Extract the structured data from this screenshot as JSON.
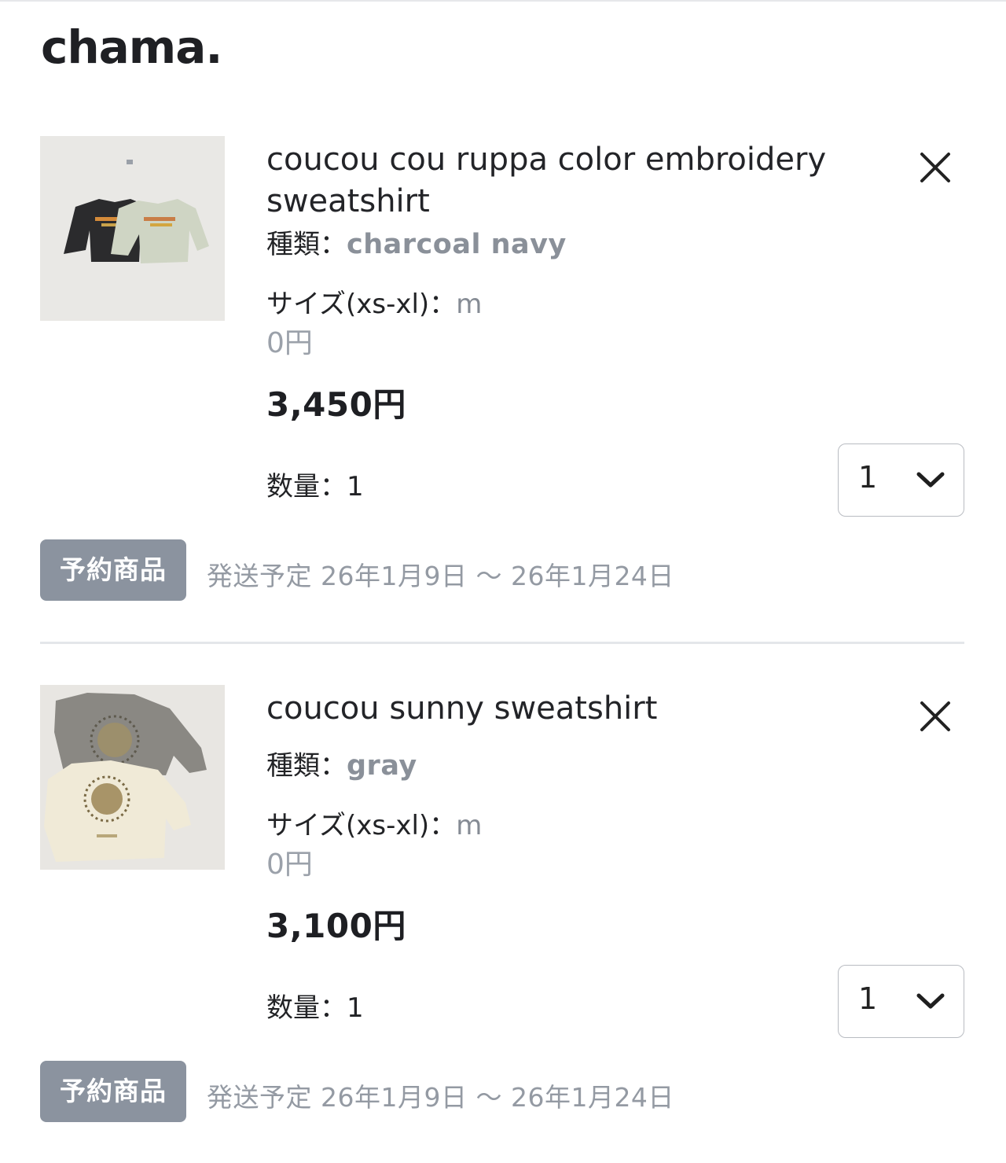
{
  "header": {
    "logo": "chama."
  },
  "cart": {
    "items": [
      {
        "title": "coucou cou ruppa color embroidery sweatshirt",
        "variant_label": "種類：",
        "variant_value": "charcoal navy",
        "size_label": "サイズ(xs-xl)：",
        "size_value": "m",
        "option_price": "0円",
        "price": "3,450円",
        "quantity_label": "数量：1",
        "quantity_selected": "1",
        "badge": "予約商品",
        "shipping": "発送予定 26年1月9日 ～ 26年1月24日",
        "image_icon": "sweatshirt-photo"
      },
      {
        "title": "coucou sunny sweatshirt",
        "variant_label": "種類：",
        "variant_value": "gray",
        "size_label": "サイズ(xs-xl)：",
        "size_value": "m",
        "option_price": "0円",
        "price": "3,100円",
        "quantity_label": "数量：1",
        "quantity_selected": "1",
        "badge": "予約商品",
        "shipping": "発送予定 26年1月9日 ～ 26年1月24日",
        "image_icon": "sweatshirt-photo"
      }
    ]
  },
  "icons": {
    "remove": "close-icon",
    "dropdown": "chevron-down-icon"
  },
  "colors": {
    "badge_bg": "#8b939f",
    "muted_text": "#858b94",
    "text": "#222326",
    "divider": "#e4e6ea"
  }
}
